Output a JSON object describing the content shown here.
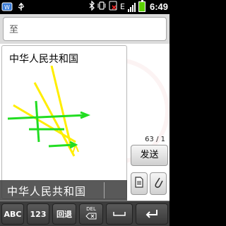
{
  "status_bar": {
    "network_label": "E",
    "time": "6:49"
  },
  "compose": {
    "to_placeholder": "至",
    "message_text": "中华人民共和国",
    "char_counter": "63 / 1",
    "send_label": "发送"
  },
  "candidate": {
    "text": "中华人民共和国"
  },
  "keyboard": {
    "abc_label": "ABC",
    "num_label": "123",
    "back_label": "回退",
    "del_label": "DEL"
  },
  "colors": {
    "stroke_yellow": "#ffee00",
    "stroke_green": "#22dd22"
  }
}
